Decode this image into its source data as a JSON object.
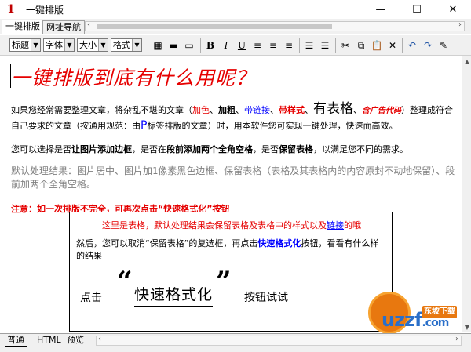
{
  "window": {
    "icon_glyph": "1",
    "title": "一键排版",
    "minimize": "—",
    "maximize": "☐",
    "close": "✕"
  },
  "tabs": [
    {
      "label": "一键排版"
    },
    {
      "label": "网址导航"
    }
  ],
  "toolbar": {
    "selects": [
      "标题",
      "字体",
      "大小",
      "格式"
    ],
    "bold": "B",
    "italic": "I",
    "underline": "U"
  },
  "content": {
    "headline": "一键排版到底有什么用呢？",
    "p1": {
      "a": "如果您经常需要整理文章，将杂乱不堪的文章（",
      "red": "加色",
      "sep1": "、",
      "bold": "加粗",
      "sep2": "、",
      "link": "带链接",
      "sep3": "、",
      "style": "带样式",
      "sep4": "、",
      "table": "有表格",
      "sep5": "、",
      "ad": "含广告代码",
      "b": "）整理成符合自己要求的文章（按通用规范：由",
      "p": "P",
      "c": "标签排版的文章）时，用本软件您可实现一键处理，快速而高效。"
    },
    "p2": {
      "a": "您可以选择是否",
      "b1": "让图片添加边框",
      "b": "，是否在",
      "b2": "段前添加两个全角空格",
      "c": "，是否",
      "b3": "保留表格",
      "d": "，以满足您不同的需求。"
    },
    "p3": "默认处理结果：图片居中、图片加1像素黑色边框、保留表格（表格及其表格内的内容原封不动地保留）、段前加两个全角空格。",
    "p4": "注意：如一次排版不完全，可再次点击“快速格式化”按钮",
    "demo": {
      "note_a": "这里是表格，默认处理结果会保留表格及表格中的样式以及",
      "note_link": "链接",
      "note_b": "的哦",
      "body_a": "然后，您可以取消“保留表格”的复选框，再点击",
      "body_b": "快速格式化",
      "body_c": "按钮，看看有什么样的结果",
      "click": "点击",
      "quote_l": "“",
      "button_label": "快速格式化",
      "quote_r": "”",
      "try": "按钮试试"
    }
  },
  "watermark": {
    "text": "uzzf",
    "suffix": ".com",
    "badge": "东坡下载"
  },
  "bottom_tabs": [
    {
      "label": "普通"
    },
    {
      "label": "HTML"
    },
    {
      "label": "预览"
    }
  ]
}
